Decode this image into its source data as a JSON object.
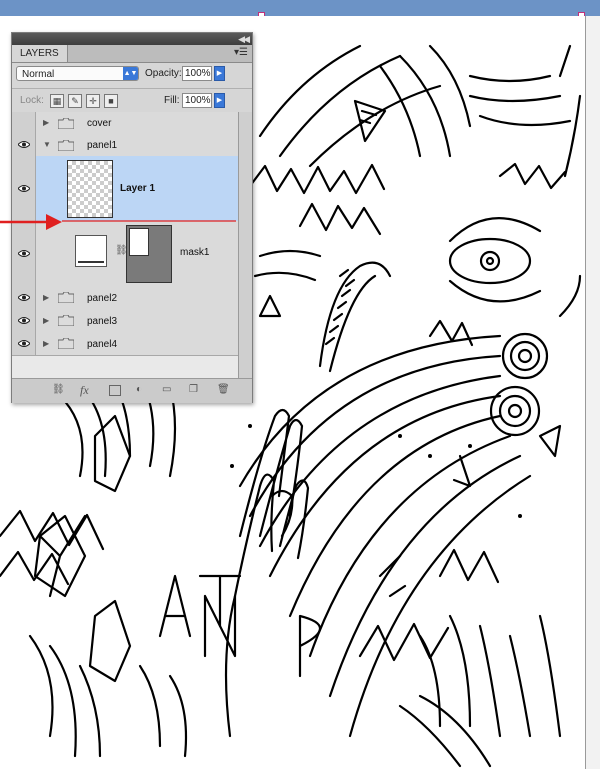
{
  "panel": {
    "tab_label": "LAYERS",
    "menu_icon": "panel-menu-icon",
    "blend_mode": "Normal",
    "opacity_label": "Opacity:",
    "opacity_value": "100%",
    "lock_label": "Lock:",
    "fill_label": "Fill:",
    "fill_value": "100%"
  },
  "layers": [
    {
      "name": "cover",
      "visible": false,
      "type": "group",
      "expanded": false
    },
    {
      "name": "panel1",
      "visible": true,
      "type": "group",
      "expanded": true
    },
    {
      "name": "Layer 1",
      "visible": true,
      "type": "layer",
      "selected": true
    },
    {
      "name": "mask1",
      "visible": true,
      "type": "mask"
    },
    {
      "name": "panel2",
      "visible": true,
      "type": "group",
      "expanded": false
    },
    {
      "name": "panel3",
      "visible": true,
      "type": "group",
      "expanded": false
    },
    {
      "name": "panel4",
      "visible": true,
      "type": "group",
      "expanded": false
    }
  ],
  "colors": {
    "selection": "#bcd6f5",
    "accent": "#3a78d8",
    "indicator_arrow": "#e02020"
  },
  "icons": [
    "link-layers-icon",
    "fx-icon",
    "add-mask-icon",
    "adjustment-icon",
    "new-group-icon",
    "new-layer-icon",
    "trash-icon"
  ]
}
